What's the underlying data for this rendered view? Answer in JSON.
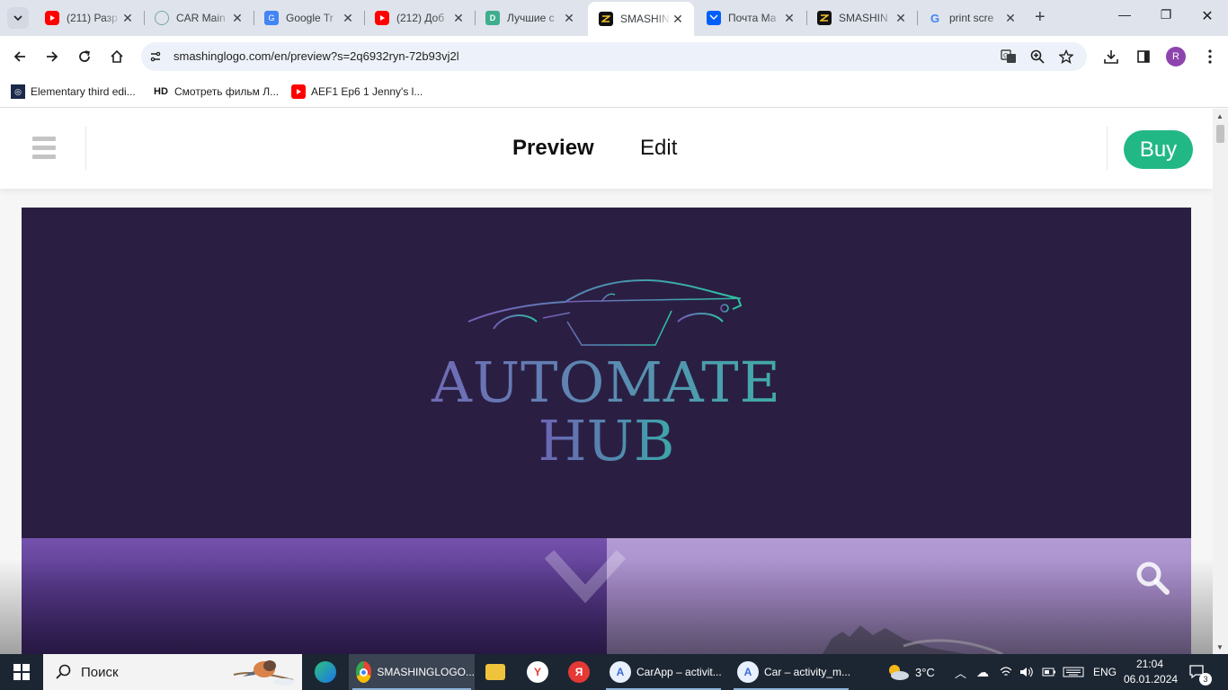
{
  "browser": {
    "tabs": [
      {
        "title": "(211) Разр",
        "icon": "youtube-icon",
        "color": "#ff0000"
      },
      {
        "title": "CAR Main",
        "icon": "chatgpt-icon",
        "color": "#74aa9c"
      },
      {
        "title": "Google Tr",
        "icon": "google-translate-icon",
        "color": "#4285f4"
      },
      {
        "title": "(212) Доб",
        "icon": "youtube-icon",
        "color": "#ff0000"
      },
      {
        "title": "Лучшие с",
        "icon": "d-logo-icon",
        "color": "#3fae8e"
      },
      {
        "title": "SMASHIN",
        "icon": "smashinglogo-icon",
        "color": "#f2c230"
      },
      {
        "title": "Почта Ма",
        "icon": "mail-icon",
        "color": "#005ff9"
      },
      {
        "title": "SMASHIN",
        "icon": "smashinglogo-icon",
        "color": "#f2c230"
      },
      {
        "title": "print scre",
        "icon": "google-icon",
        "color": "#4285f4"
      }
    ],
    "active_tab_index": 5,
    "url": "smashinglogo.com/en/preview?s=2q6932ryn-72b93vj2l",
    "profile_initial": "R",
    "bookmarks": [
      {
        "label": "Elementary third edi...",
        "icon": "dark-square-icon"
      },
      {
        "label": "Смотреть фильм Л...",
        "icon": "hd-icon",
        "icon_text": "HD"
      },
      {
        "label": "AEF1 Ep6 1 Jenny's l...",
        "icon": "youtube-icon"
      }
    ]
  },
  "site": {
    "nav_preview": "Preview",
    "nav_edit": "Edit",
    "buy_label": "Buy",
    "accent": "#22b886"
  },
  "logo": {
    "line1": "AUTOMATE",
    "line2": "HUB",
    "background": "#2a1f42"
  },
  "taskbar": {
    "search_label": "Поиск",
    "apps": [
      {
        "label": "SMASHINGLOGO...",
        "icon": "chrome-icon"
      },
      {
        "label": "CarApp – activit...",
        "icon": "android-studio-icon"
      },
      {
        "label": "Car – activity_m...",
        "icon": "android-studio-icon"
      }
    ],
    "weather": "3°C",
    "language": "ENG",
    "time": "21:04",
    "date": "06.01.2024",
    "notifications": "3"
  }
}
